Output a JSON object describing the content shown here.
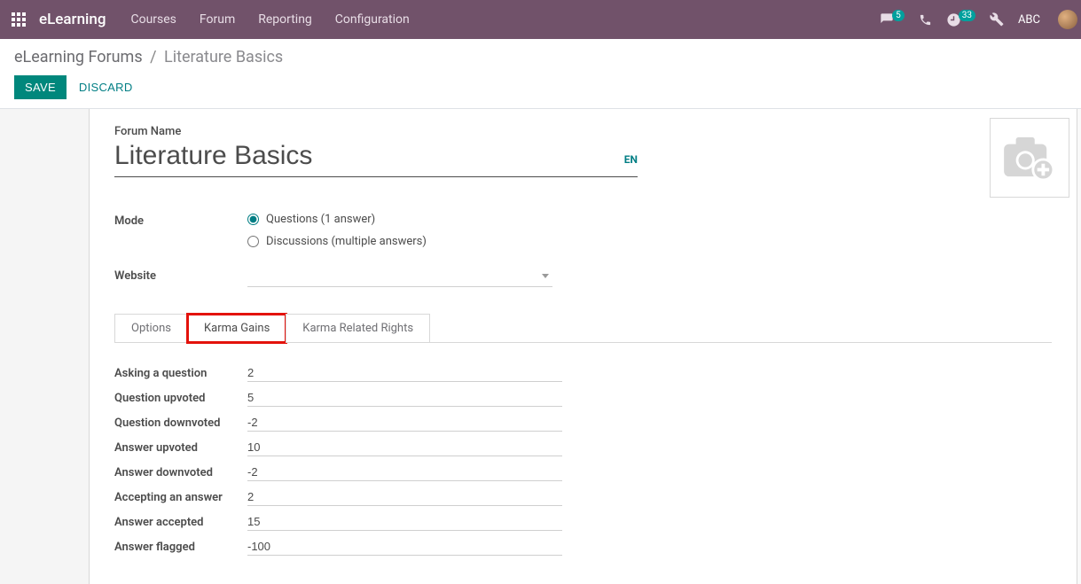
{
  "navbar": {
    "brand": "eLearning",
    "links": [
      "Courses",
      "Forum",
      "Reporting",
      "Configuration"
    ],
    "messages_badge": "5",
    "activities_badge": "33",
    "user": "ABC"
  },
  "breadcrumb": {
    "parent": "eLearning Forums",
    "current": "Literature Basics"
  },
  "buttons": {
    "save": "SAVE",
    "discard": "DISCARD"
  },
  "form": {
    "forum_name_label": "Forum Name",
    "forum_name": "Literature Basics",
    "lang": "EN",
    "mode_label": "Mode",
    "mode_options": {
      "questions": "Questions (1 answer)",
      "discussions": "Discussions (multiple answers)"
    },
    "mode_selected": "questions",
    "website_label": "Website",
    "website_value": ""
  },
  "tabs": {
    "options": "Options",
    "karma_gains": "Karma Gains",
    "karma_rights": "Karma Related Rights",
    "active": "karma_gains"
  },
  "karma": {
    "rows": [
      {
        "label": "Asking a question",
        "value": "2"
      },
      {
        "label": "Question upvoted",
        "value": "5"
      },
      {
        "label": "Question downvoted",
        "value": "-2"
      },
      {
        "label": "Answer upvoted",
        "value": "10"
      },
      {
        "label": "Answer downvoted",
        "value": "-2"
      },
      {
        "label": "Accepting an answer",
        "value": "2"
      },
      {
        "label": "Answer accepted",
        "value": "15"
      },
      {
        "label": "Answer flagged",
        "value": "-100"
      }
    ]
  }
}
